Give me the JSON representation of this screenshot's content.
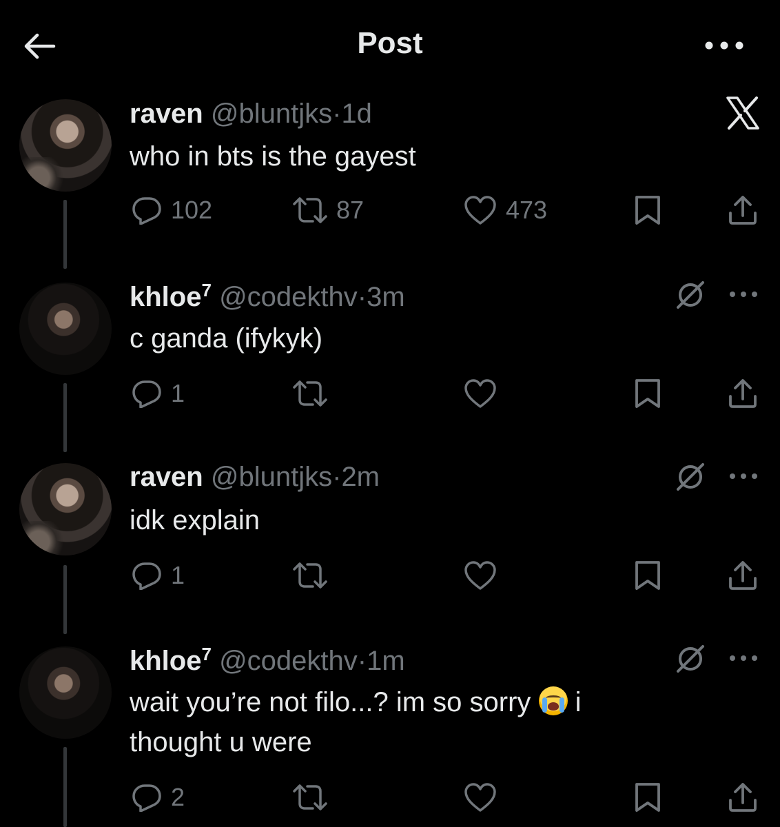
{
  "header": {
    "title": "Post"
  },
  "tweets": [
    {
      "name": "raven",
      "sup": "",
      "handle": "@bluntjks",
      "dot": "·",
      "time": "1d",
      "text": "who in bts is the gayest",
      "replies": "102",
      "retweets": "87",
      "likes": "473"
    },
    {
      "name": "khloe",
      "sup": "7",
      "handle": "@codekthv",
      "dot": "·",
      "time": "3m",
      "text": "c ganda (ifykyk)",
      "replies": "1",
      "retweets": "",
      "likes": ""
    },
    {
      "name": "raven",
      "sup": "",
      "handle": "@bluntjks",
      "dot": "·",
      "time": "2m",
      "text": "idk explain",
      "replies": "1",
      "retweets": "",
      "likes": ""
    },
    {
      "name": "khloe",
      "sup": "7",
      "handle": "@codekthv",
      "dot": "·",
      "time": "1m",
      "text_before_emoji": "wait you’re not filo...? im so sorry",
      "text_after_emoji": "i thought u were",
      "replies": "2",
      "retweets": "",
      "likes": ""
    }
  ],
  "colors": {
    "background": "#000000",
    "primary_text": "#e7e9ea",
    "secondary_text": "#71767b",
    "thread_line": "#333639"
  },
  "icons": {
    "back": "arrow-left-icon",
    "more": "more-dots-icon",
    "brand": "x-logo-icon",
    "reply": "reply-icon",
    "retweet": "retweet-icon",
    "like": "heart-icon",
    "bookmark": "bookmark-icon",
    "share": "share-icon",
    "grok": "grok-icon"
  }
}
